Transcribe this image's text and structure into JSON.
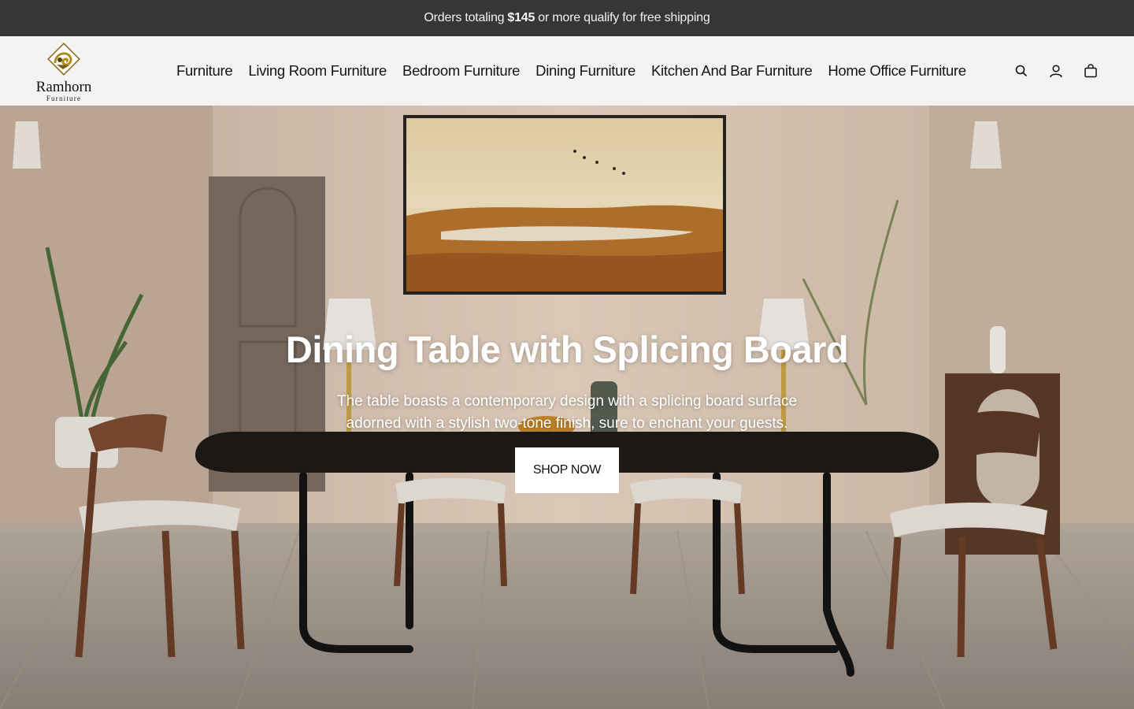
{
  "announcement": {
    "prefix": "Orders totaling",
    "amount": "$145",
    "suffix": "or more qualify for free shipping"
  },
  "header": {
    "logo": {
      "name": "Ramhorn",
      "sub": "Furniture"
    },
    "nav": [
      {
        "label": "Furniture"
      },
      {
        "label": "Living Room Furniture"
      },
      {
        "label": "Bedroom Furniture"
      },
      {
        "label": "Dining Furniture"
      },
      {
        "label": "Kitchen And Bar Furniture"
      },
      {
        "label": "Home Office Furniture"
      }
    ],
    "icons": [
      "search-icon",
      "account-icon",
      "cart-icon"
    ]
  },
  "hero": {
    "title": "Dining Table with Splicing Board",
    "description": "The table boasts a contemporary design with a splicing board surface adorned with a stylish two-tone finish, sure to enchant your guests.",
    "button": "SHOP NOW"
  },
  "colors": {
    "announcement_bg": "#363636",
    "header_bg": "#f3f3f3",
    "logo_gold": "#b08a1f"
  }
}
